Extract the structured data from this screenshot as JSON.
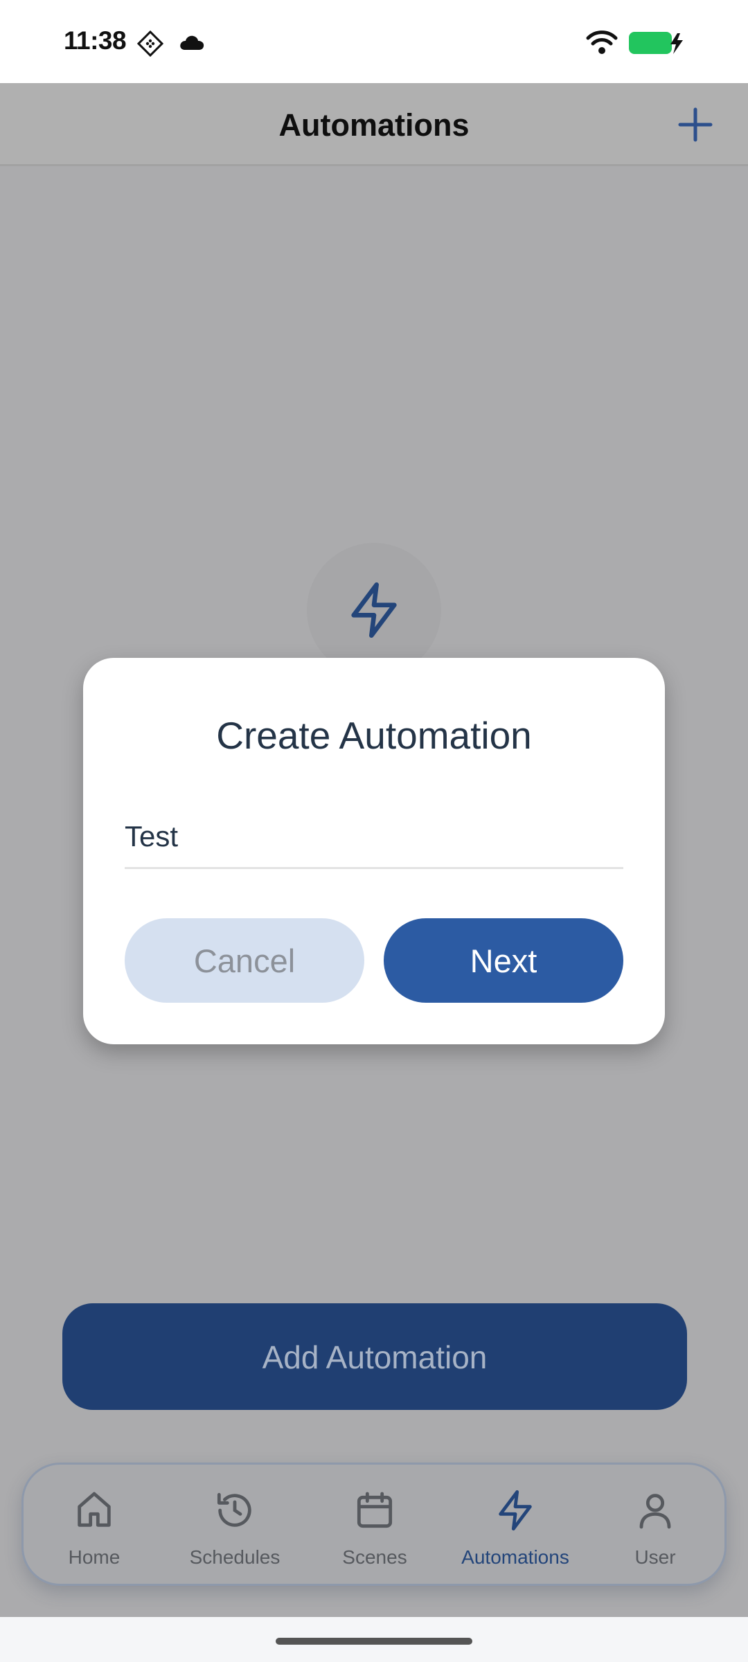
{
  "status_bar": {
    "time": "11:38",
    "icons": [
      "diamond-notification-icon",
      "cloud-icon",
      "wifi-icon",
      "battery-charging-icon"
    ],
    "battery_color": "#22c55e"
  },
  "header": {
    "title": "Automations",
    "add_icon": "plus-icon",
    "accent": "#2c4f8c"
  },
  "empty_state": {
    "icon": "lightning-icon"
  },
  "main": {
    "add_button_label": "Add Automation"
  },
  "dialog": {
    "title": "Create Automation",
    "input_value": "Test",
    "cancel_label": "Cancel",
    "next_label": "Next"
  },
  "bottom_nav": {
    "items": [
      {
        "label": "Home",
        "icon": "home-icon",
        "active": false
      },
      {
        "label": "Schedules",
        "icon": "history-icon",
        "active": false
      },
      {
        "label": "Scenes",
        "icon": "calendar-icon",
        "active": false
      },
      {
        "label": "Automations",
        "icon": "lightning-icon",
        "active": true
      },
      {
        "label": "User",
        "icon": "user-icon",
        "active": false
      }
    ]
  }
}
